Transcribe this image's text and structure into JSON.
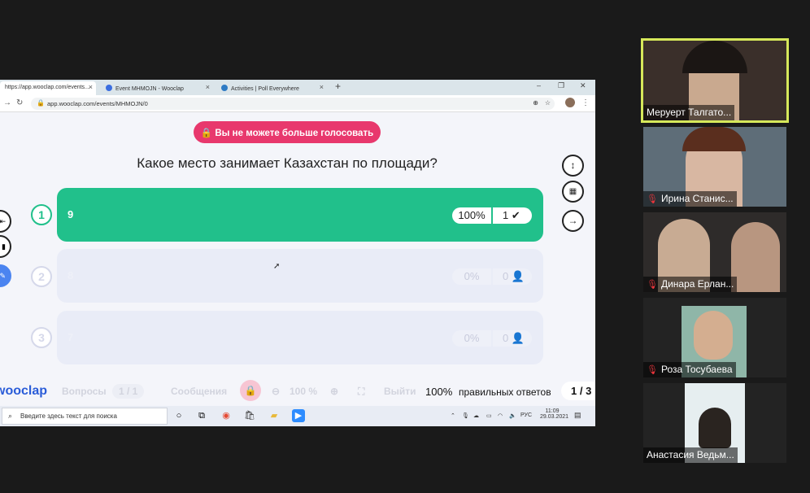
{
  "browser": {
    "tabs": [
      {
        "label": "https://app.wooclap.com/events..."
      },
      {
        "label": "Event MHMOJN - Wooclap"
      },
      {
        "label": "Activities | Poll Everywhere"
      }
    ],
    "new_tab": "+",
    "url": "app.wooclap.com/events/MHMOJN/0"
  },
  "poll": {
    "locked_banner": "Вы не можете больше голосовать",
    "question": "Какое место занимает Казахстан по площади?",
    "options": [
      {
        "number": "1",
        "label": "9",
        "percent": "100%",
        "count": "1",
        "correct": true
      },
      {
        "number": "2",
        "label": "8",
        "percent": "0%",
        "count": "0",
        "correct": false
      },
      {
        "number": "3",
        "label": "7",
        "percent": "0%",
        "count": "0",
        "correct": false
      }
    ]
  },
  "bottombar": {
    "brand": "wooclap",
    "questions_label": "Вопросы",
    "questions_page": "1 / 1",
    "messages_label": "Сообщения",
    "zoom": "100 %",
    "exit_label": "Выйти",
    "correct_stat": "100%",
    "correct_label": "правильных ответов",
    "pager": "1 / 3"
  },
  "taskbar": {
    "search_placeholder": "Введите здесь текст для поиска",
    "lang": "РУС",
    "time": "11:09",
    "date": "29.03.2021"
  },
  "participants": [
    {
      "name": "Меруерт Талгато...",
      "muted": false,
      "active": true
    },
    {
      "name": "Ирина Станис...",
      "muted": true,
      "active": false
    },
    {
      "name": "Динара Ерлан...",
      "muted": true,
      "active": false
    },
    {
      "name": "Роза Тосубаева",
      "muted": true,
      "active": false
    },
    {
      "name": "Анастасия Ведьм...",
      "muted": false,
      "active": false
    }
  ],
  "colors": {
    "correct": "#21c08b",
    "locked": "#e8386d",
    "active_speaker": "#d6e85a"
  }
}
